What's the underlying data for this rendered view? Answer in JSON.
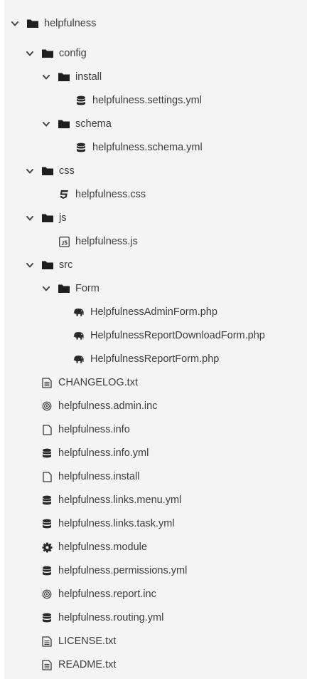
{
  "tree": {
    "root": {
      "label": "helpfulness",
      "icon": "folder-icon"
    },
    "config": {
      "label": "config",
      "icon": "folder-icon"
    },
    "install": {
      "label": "install",
      "icon": "folder-icon"
    },
    "settings_yml": {
      "label": "helpfulness.settings.yml",
      "icon": "database-icon"
    },
    "schema": {
      "label": "schema",
      "icon": "folder-icon"
    },
    "schema_yml": {
      "label": "helpfulness.schema.yml",
      "icon": "database-icon"
    },
    "css": {
      "label": "css",
      "icon": "folder-icon"
    },
    "css_file": {
      "label": "helpfulness.css",
      "icon": "css3-icon"
    },
    "js": {
      "label": "js",
      "icon": "folder-icon"
    },
    "js_file": {
      "label": "helpfulness.js",
      "icon": "js-icon"
    },
    "src": {
      "label": "src",
      "icon": "folder-icon"
    },
    "form": {
      "label": "Form",
      "icon": "folder-icon"
    },
    "admin_form": {
      "label": "HelpfulnessAdminForm.php",
      "icon": "php-elephant-icon"
    },
    "report_download_form": {
      "label": "HelpfulnessReportDownloadForm.php",
      "icon": "php-elephant-icon"
    },
    "report_form": {
      "label": "HelpfulnessReportForm.php",
      "icon": "php-elephant-icon"
    },
    "changelog": {
      "label": "CHANGELOG.txt",
      "icon": "text-file-icon"
    },
    "admin_inc": {
      "label": "helpfulness.admin.inc",
      "icon": "at-sign-icon"
    },
    "info": {
      "label": "helpfulness.info",
      "icon": "blank-file-icon"
    },
    "info_yml": {
      "label": "helpfulness.info.yml",
      "icon": "database-icon"
    },
    "install_file": {
      "label": "helpfulness.install",
      "icon": "blank-file-icon"
    },
    "links_menu": {
      "label": "helpfulness.links.menu.yml",
      "icon": "database-icon"
    },
    "links_task": {
      "label": "helpfulness.links.task.yml",
      "icon": "database-icon"
    },
    "module": {
      "label": "helpfulness.module",
      "icon": "gear-icon"
    },
    "permissions": {
      "label": "helpfulness.permissions.yml",
      "icon": "database-icon"
    },
    "report_inc": {
      "label": "helpfulness.report.inc",
      "icon": "at-sign-icon"
    },
    "routing": {
      "label": "helpfulness.routing.yml",
      "icon": "database-icon"
    },
    "license": {
      "label": "LICENSE.txt",
      "icon": "text-file-icon"
    },
    "readme": {
      "label": "README.txt",
      "icon": "text-file-icon"
    }
  }
}
